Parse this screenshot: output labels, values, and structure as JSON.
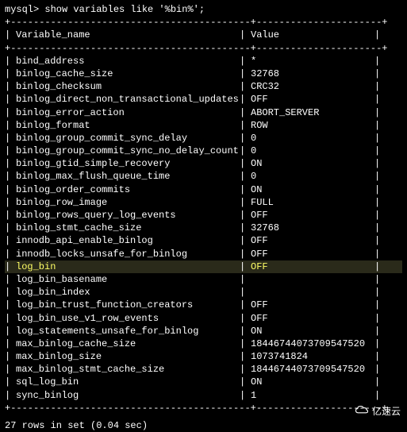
{
  "prompt": "mysql> show variables like '%bin%';",
  "header": {
    "col1": "Variable_name",
    "col2": "Value"
  },
  "rows": [
    {
      "name": "bind_address",
      "value": "*"
    },
    {
      "name": "binlog_cache_size",
      "value": "32768"
    },
    {
      "name": "binlog_checksum",
      "value": "CRC32"
    },
    {
      "name": "binlog_direct_non_transactional_updates",
      "value": "OFF"
    },
    {
      "name": "binlog_error_action",
      "value": "ABORT_SERVER"
    },
    {
      "name": "binlog_format",
      "value": "ROW"
    },
    {
      "name": "binlog_group_commit_sync_delay",
      "value": "0"
    },
    {
      "name": "binlog_group_commit_sync_no_delay_count",
      "value": "0"
    },
    {
      "name": "binlog_gtid_simple_recovery",
      "value": "ON"
    },
    {
      "name": "binlog_max_flush_queue_time",
      "value": "0"
    },
    {
      "name": "binlog_order_commits",
      "value": "ON"
    },
    {
      "name": "binlog_row_image",
      "value": "FULL"
    },
    {
      "name": "binlog_rows_query_log_events",
      "value": "OFF"
    },
    {
      "name": "binlog_stmt_cache_size",
      "value": "32768"
    },
    {
      "name": "innodb_api_enable_binlog",
      "value": "OFF"
    },
    {
      "name": "innodb_locks_unsafe_for_binlog",
      "value": "OFF"
    },
    {
      "name": "log_bin",
      "value": "OFF",
      "highlight": true
    },
    {
      "name": "log_bin_basename",
      "value": ""
    },
    {
      "name": "log_bin_index",
      "value": ""
    },
    {
      "name": "log_bin_trust_function_creators",
      "value": "OFF"
    },
    {
      "name": "log_bin_use_v1_row_events",
      "value": "OFF"
    },
    {
      "name": "log_statements_unsafe_for_binlog",
      "value": "ON"
    },
    {
      "name": "max_binlog_cache_size",
      "value": "18446744073709547520"
    },
    {
      "name": "max_binlog_size",
      "value": "1073741824"
    },
    {
      "name": "max_binlog_stmt_cache_size",
      "value": "18446744073709547520"
    },
    {
      "name": "sql_log_bin",
      "value": "ON"
    },
    {
      "name": "sync_binlog",
      "value": "1"
    }
  ],
  "footer": "27 rows in set (0.04 sec)",
  "watermark": "亿速云",
  "border": "+------------------------------------------+----------------------+",
  "chart_data": {
    "type": "table",
    "title": "MySQL variables like '%bin%'",
    "columns": [
      "Variable_name",
      "Value"
    ],
    "data": [
      [
        "bind_address",
        "*"
      ],
      [
        "binlog_cache_size",
        "32768"
      ],
      [
        "binlog_checksum",
        "CRC32"
      ],
      [
        "binlog_direct_non_transactional_updates",
        "OFF"
      ],
      [
        "binlog_error_action",
        "ABORT_SERVER"
      ],
      [
        "binlog_format",
        "ROW"
      ],
      [
        "binlog_group_commit_sync_delay",
        "0"
      ],
      [
        "binlog_group_commit_sync_no_delay_count",
        "0"
      ],
      [
        "binlog_gtid_simple_recovery",
        "ON"
      ],
      [
        "binlog_max_flush_queue_time",
        "0"
      ],
      [
        "binlog_order_commits",
        "ON"
      ],
      [
        "binlog_row_image",
        "FULL"
      ],
      [
        "binlog_rows_query_log_events",
        "OFF"
      ],
      [
        "binlog_stmt_cache_size",
        "32768"
      ],
      [
        "innodb_api_enable_binlog",
        "OFF"
      ],
      [
        "innodb_locks_unsafe_for_binlog",
        "OFF"
      ],
      [
        "log_bin",
        "OFF"
      ],
      [
        "log_bin_basename",
        ""
      ],
      [
        "log_bin_index",
        ""
      ],
      [
        "log_bin_trust_function_creators",
        "OFF"
      ],
      [
        "log_bin_use_v1_row_events",
        "OFF"
      ],
      [
        "log_statements_unsafe_for_binlog",
        "ON"
      ],
      [
        "max_binlog_cache_size",
        "18446744073709547520"
      ],
      [
        "max_binlog_size",
        "1073741824"
      ],
      [
        "max_binlog_stmt_cache_size",
        "18446744073709547520"
      ],
      [
        "sql_log_bin",
        "ON"
      ],
      [
        "sync_binlog",
        "1"
      ]
    ]
  }
}
